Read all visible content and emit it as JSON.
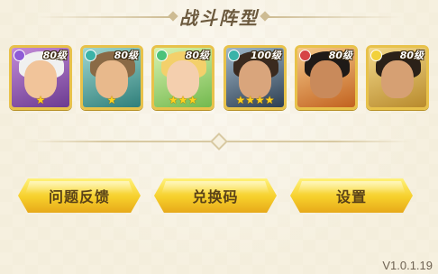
{
  "title": "战斗阵型",
  "heroes": [
    {
      "level": "80级",
      "stars": "★",
      "gem_color": "#8e5bd6"
    },
    {
      "level": "80级",
      "stars": "★",
      "gem_color": "#3bb3a8"
    },
    {
      "level": "80级",
      "stars": "★★★",
      "gem_color": "#4cc27a"
    },
    {
      "level": "100级",
      "stars": "★★★★",
      "gem_color": "#3bb3a8"
    },
    {
      "level": "80级",
      "stars": "",
      "gem_color": "#d64545"
    },
    {
      "level": "80级",
      "stars": "",
      "gem_color": "#f2d13a"
    }
  ],
  "buttons": {
    "feedback": "问题反馈",
    "redeem": "兑换码",
    "settings": "设置"
  },
  "version": "V1.0.1.19"
}
